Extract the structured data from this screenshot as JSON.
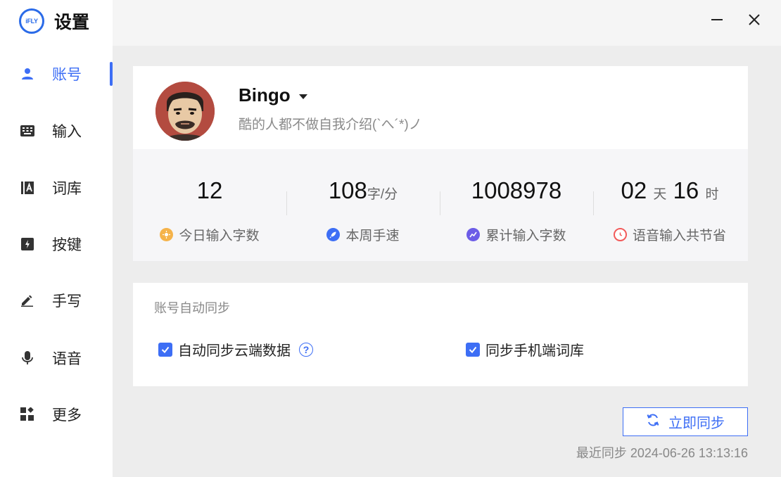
{
  "app": {
    "title": "设置",
    "logo_text": "iFLY"
  },
  "sidebar": {
    "items": [
      {
        "label": "账号",
        "icon": "user-icon"
      },
      {
        "label": "输入",
        "icon": "keyboard-icon"
      },
      {
        "label": "词库",
        "icon": "dictionary-icon"
      },
      {
        "label": "按键",
        "icon": "key-icon"
      },
      {
        "label": "手写",
        "icon": "pen-icon"
      },
      {
        "label": "语音",
        "icon": "microphone-icon"
      },
      {
        "label": "更多",
        "icon": "apps-icon"
      }
    ],
    "active_index": 0
  },
  "window": {
    "minimize_icon": "minimize-icon",
    "close_icon": "close-icon"
  },
  "profile": {
    "username": "Bingo",
    "bio": "酷的人都不做自我介绍(`へ´*)ノ"
  },
  "stats": [
    {
      "value": "12",
      "unit": "",
      "label": "今日输入字数",
      "icon": "sun-icon",
      "color": "#f5b34a"
    },
    {
      "value": "108",
      "unit": "字/分",
      "label": "本周手速",
      "icon": "rocket-icon",
      "color": "#3d6ef5"
    },
    {
      "value": "1008978",
      "unit": "",
      "label": "累计输入字数",
      "icon": "trend-icon",
      "color": "#6c5ce7"
    },
    {
      "days": "02",
      "days_unit": "天",
      "hours": "16",
      "hours_unit": "时",
      "label": "语音输入共节省",
      "icon": "clock-icon",
      "color": "#f25a5a"
    }
  ],
  "sync": {
    "section_title": "账号自动同步",
    "options": [
      {
        "label": "自动同步云端数据",
        "checked": true
      },
      {
        "label": "同步手机端词库",
        "checked": true
      }
    ],
    "sync_now_label": "立即同步",
    "last_sync": "最近同步 2024-06-26 13:13:16"
  },
  "colors": {
    "accent": "#3d6ef5",
    "sidebar_bg": "#ffffff",
    "content_bg": "#ededed"
  }
}
